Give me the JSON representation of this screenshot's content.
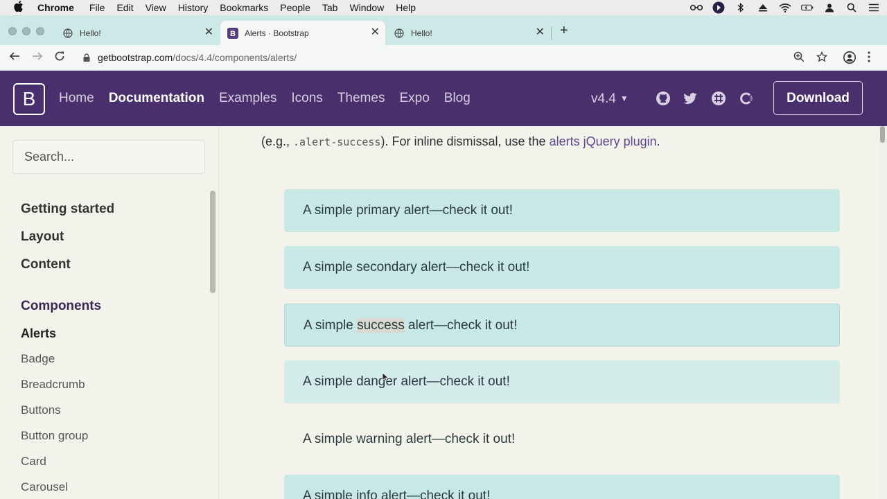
{
  "menubar": {
    "app": "Chrome",
    "items": [
      "File",
      "Edit",
      "View",
      "History",
      "Bookmarks",
      "People",
      "Tab",
      "Window",
      "Help"
    ]
  },
  "tabs": [
    {
      "title": "Hello!",
      "favicon": "globe-icon"
    },
    {
      "title": "Alerts · Bootstrap",
      "favicon": "bootstrap-icon"
    },
    {
      "title": "Hello!",
      "favicon": "globe-icon"
    }
  ],
  "address": {
    "host": "getbootstrap.com",
    "path": "/docs/4.4/components/alerts/"
  },
  "bsnav": {
    "logo": "B",
    "links": [
      "Home",
      "Documentation",
      "Examples",
      "Icons",
      "Themes",
      "Expo",
      "Blog"
    ],
    "active": "Documentation",
    "version": "v4.4",
    "download": "Download"
  },
  "sidebar": {
    "search_placeholder": "Search...",
    "sections": [
      "Getting started",
      "Layout",
      "Content"
    ],
    "components_heading": "Components",
    "current": "Alerts",
    "items": [
      "Badge",
      "Breadcrumb",
      "Buttons",
      "Button group",
      "Card",
      "Carousel"
    ]
  },
  "main": {
    "intro_prefix": "(e.g., ",
    "intro_code": ".alert-success",
    "intro_middle": "). For inline dismissal, use the ",
    "intro_link": "alerts jQuery plugin",
    "intro_suffix": ".",
    "alerts": [
      "A simple primary alert—check it out!",
      "A simple secondary alert—check it out!",
      {
        "before": "A simple ",
        "highlight": "success",
        "after": " alert—check it out!"
      },
      "A simple danger alert—check it out!",
      "A simple warning alert—check it out!",
      "A simple info alert—check it out!"
    ]
  },
  "colors": {
    "navbar": "#4a2f6d",
    "alert_bg": "#c8e8e6",
    "tabstrip": "#cde9e7"
  }
}
